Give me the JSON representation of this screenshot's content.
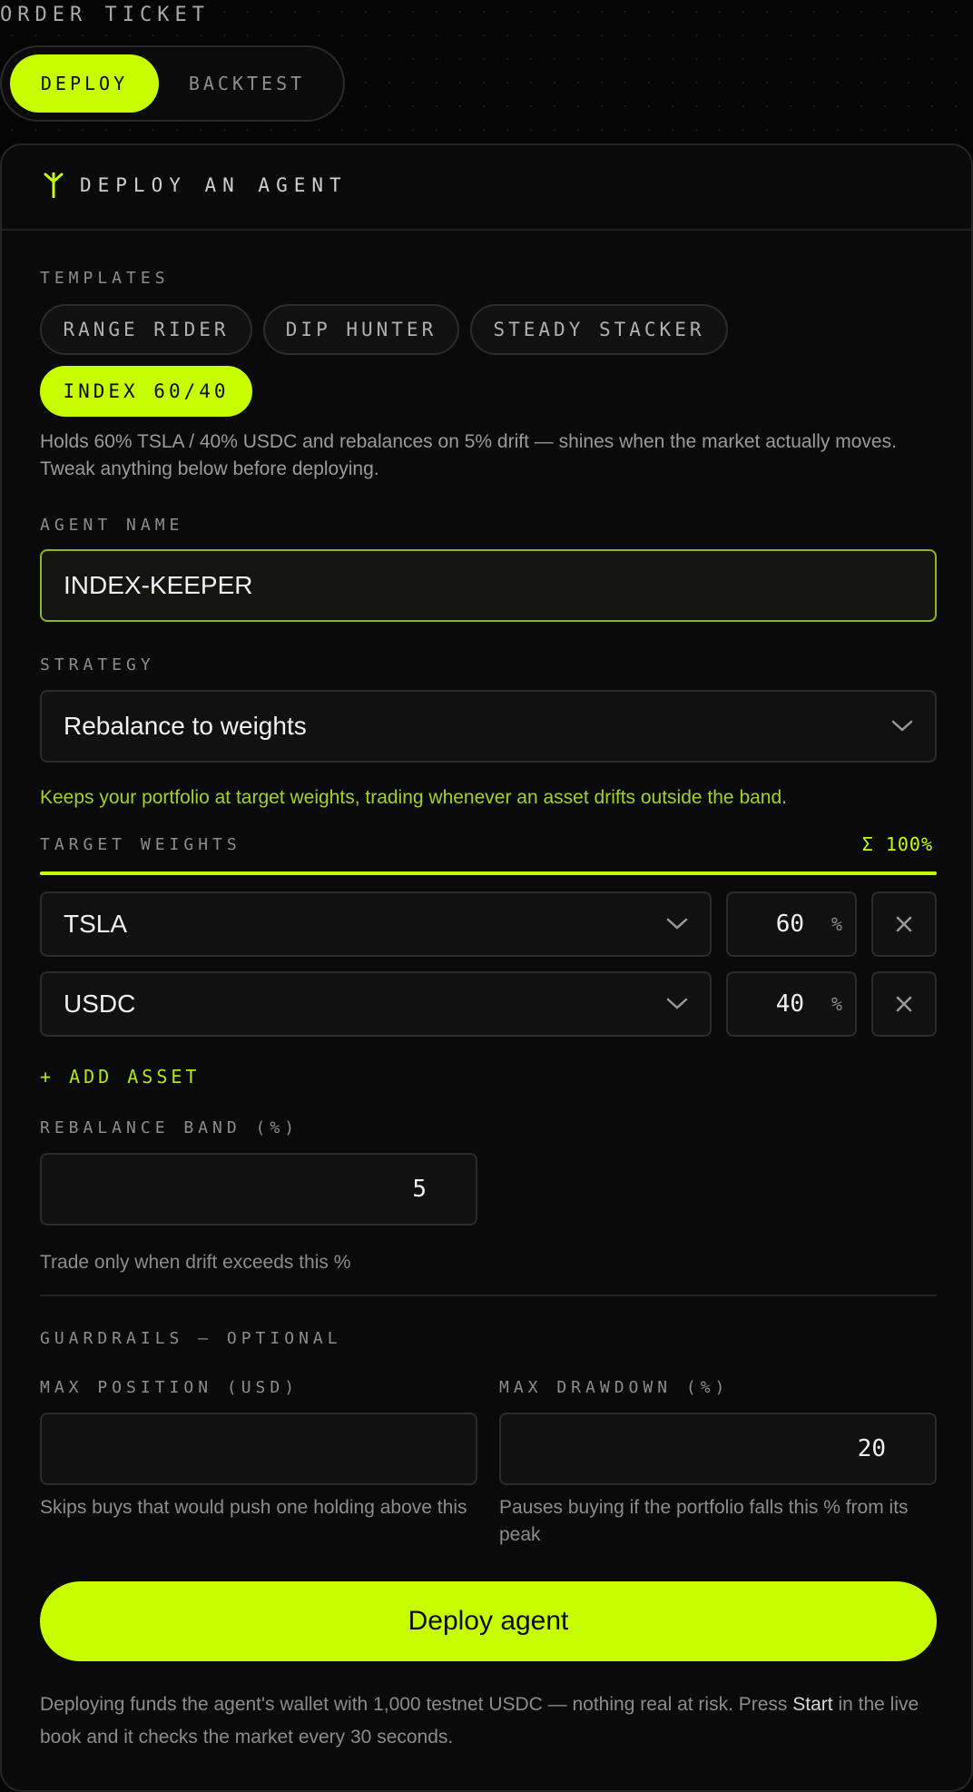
{
  "header": {
    "title": "ORDER TICKET",
    "modes": [
      {
        "label": "DEPLOY",
        "active": true
      },
      {
        "label": "BACKTEST",
        "active": false
      }
    ]
  },
  "card": {
    "title": "DEPLOY AN AGENT",
    "icon": "agent-icon",
    "templates": {
      "label": "TEMPLATES",
      "items": [
        {
          "label": "RANGE RIDER",
          "active": false
        },
        {
          "label": "DIP HUNTER",
          "active": false
        },
        {
          "label": "STEADY STACKER",
          "active": false
        },
        {
          "label": "INDEX 60/40",
          "active": true
        }
      ],
      "description": "Holds 60% TSLA / 40% USDC and rebalances on 5% drift — shines when the market actually moves. Tweak anything below before deploying."
    },
    "agent_name": {
      "label": "AGENT NAME",
      "value": "INDEX-KEEPER"
    },
    "strategy": {
      "label": "STRATEGY",
      "value": "Rebalance to weights",
      "description": "Keeps your portfolio at target weights, trading whenever an asset drifts outside the band."
    },
    "target_weights": {
      "label": "TARGET WEIGHTS",
      "sum": "Σ 100%",
      "rows": [
        {
          "asset": "TSLA",
          "weight": "60",
          "unit": "%"
        },
        {
          "asset": "USDC",
          "weight": "40",
          "unit": "%"
        }
      ],
      "add_label": "+ ADD ASSET"
    },
    "rebalance_band": {
      "label": "REBALANCE BAND (%)",
      "value": "5",
      "hint": "Trade only when drift exceeds this %"
    },
    "guardrails": {
      "label": "GUARDRAILS — OPTIONAL",
      "max_position": {
        "label": "MAX POSITION (USD)",
        "value": "",
        "hint": "Skips buys that would push one holding above this"
      },
      "max_drawdown": {
        "label": "MAX DRAWDOWN (%)",
        "value": "20",
        "hint": "Pauses buying if the portfolio falls this % from its peak"
      }
    },
    "deploy_label": "Deploy agent",
    "footer": {
      "before": "Deploying funds the agent's wallet with 1,000 testnet USDC — nothing real at risk. Press ",
      "strong": "Start",
      "after": " in the live book and it checks the market every 30 seconds."
    }
  },
  "colors": {
    "accent": "#c8ff00",
    "accent_text": "#a3d12a",
    "background": "#050505",
    "card": "#0a0a0a"
  }
}
